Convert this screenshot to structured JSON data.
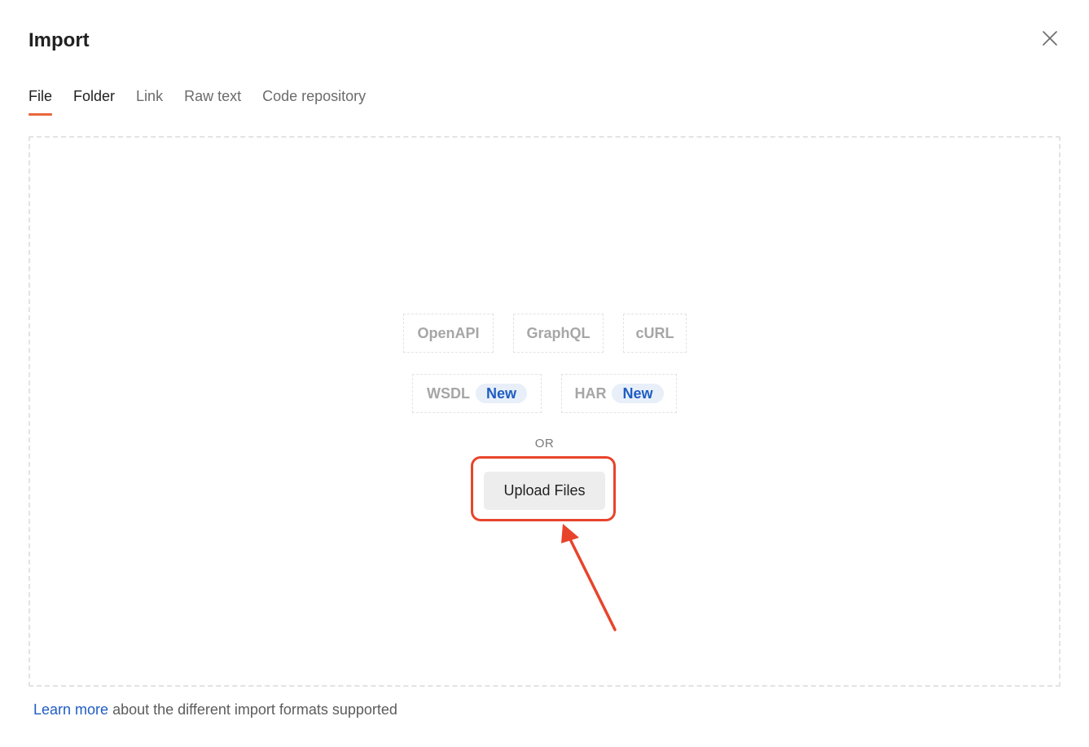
{
  "dialog": {
    "title": "Import"
  },
  "tabs": [
    {
      "label": "File",
      "active": true
    },
    {
      "label": "Folder",
      "active": false
    },
    {
      "label": "Link",
      "active": false
    },
    {
      "label": "Raw text",
      "active": false
    },
    {
      "label": "Code repository",
      "active": false
    }
  ],
  "formats": [
    {
      "label": "OpenAPI"
    },
    {
      "label": "GraphQL"
    },
    {
      "label": "cURL"
    },
    {
      "label": "WSDL",
      "badge": "New"
    },
    {
      "label": "HAR",
      "badge": "New"
    }
  ],
  "dropzone": {
    "or_text": "OR",
    "upload_label": "Upload Files"
  },
  "footer": {
    "link_text": "Learn more",
    "rest_text": " about the different import formats supported"
  },
  "colors": {
    "accent_tab": "#e8663d",
    "highlight": "#e8442b",
    "badge_text": "#1f5dc2",
    "badge_bg": "#e8eff9"
  },
  "icons": {
    "close": "close-icon"
  }
}
